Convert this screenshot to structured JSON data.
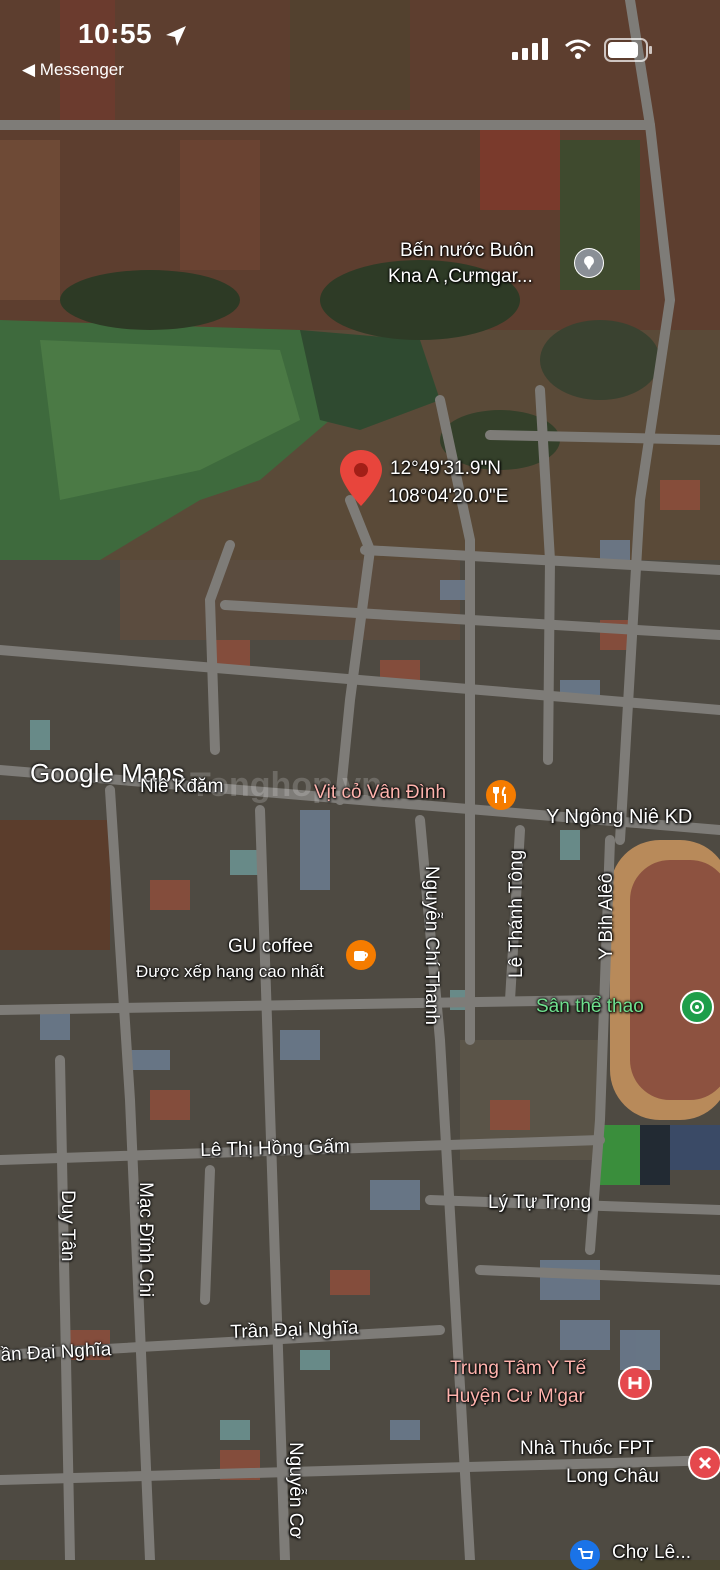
{
  "status_bar": {
    "time": "10:55",
    "back_app": "◀ Messenger"
  },
  "map": {
    "dropped_pin": {
      "lat": "12°49'31.9\"N",
      "lng": "108°04'20.0\"E"
    },
    "places": {
      "ben_nuoc_line1": "Bến nước Buôn",
      "ben_nuoc_line2": "Kna A ,Cưmgar...",
      "vit_co": "Vịt cỏ Vân Đình",
      "gu_coffee": "GU coffee",
      "gu_coffee_sub": "Được xếp hạng cao nhất",
      "san_the_thao": "Sân thể thao",
      "trung_tam_line1": "Trung Tâm Y Tế",
      "trung_tam_line2": "Huyện Cư M'gar",
      "nha_thuoc_line1": "Nhà Thuốc FPT",
      "nha_thuoc_line2": "Long Châu",
      "cho": "Chợ Lê..."
    },
    "streets": {
      "y_ngong": "Y Ngông Niê KD",
      "nie_kdam": "Niê Kđăm",
      "nguyen_chi_thanh": "Nguyễn Chí Thanh",
      "le_thanh_tong": "Lê Thánh Tông",
      "y_bih": "Y Bih Alêô",
      "le_thi_hong_gam": "Lê Thị Hồng Gấm",
      "ly_tu_trong": "Lý Tự Trọng",
      "duy_tan": "Duy Tân",
      "mac_dinh_chi": "Mạc Đĩnh Chi",
      "tran_dai_nghia": "Trần Đại Nghĩa",
      "tran_dai_nghia_left": "ần Đại Nghĩa",
      "nguyen_co": "Nguyễn Cơ"
    },
    "attribution": "Google Maps",
    "watermark": "Tonghop.vn",
    "colors": {
      "pin": "#e8453c",
      "poi_orange": "#f57c00",
      "poi_green": "#1e9e4a",
      "poi_hospital": "#e5484d",
      "poi_grey": "#8a8f96"
    }
  }
}
